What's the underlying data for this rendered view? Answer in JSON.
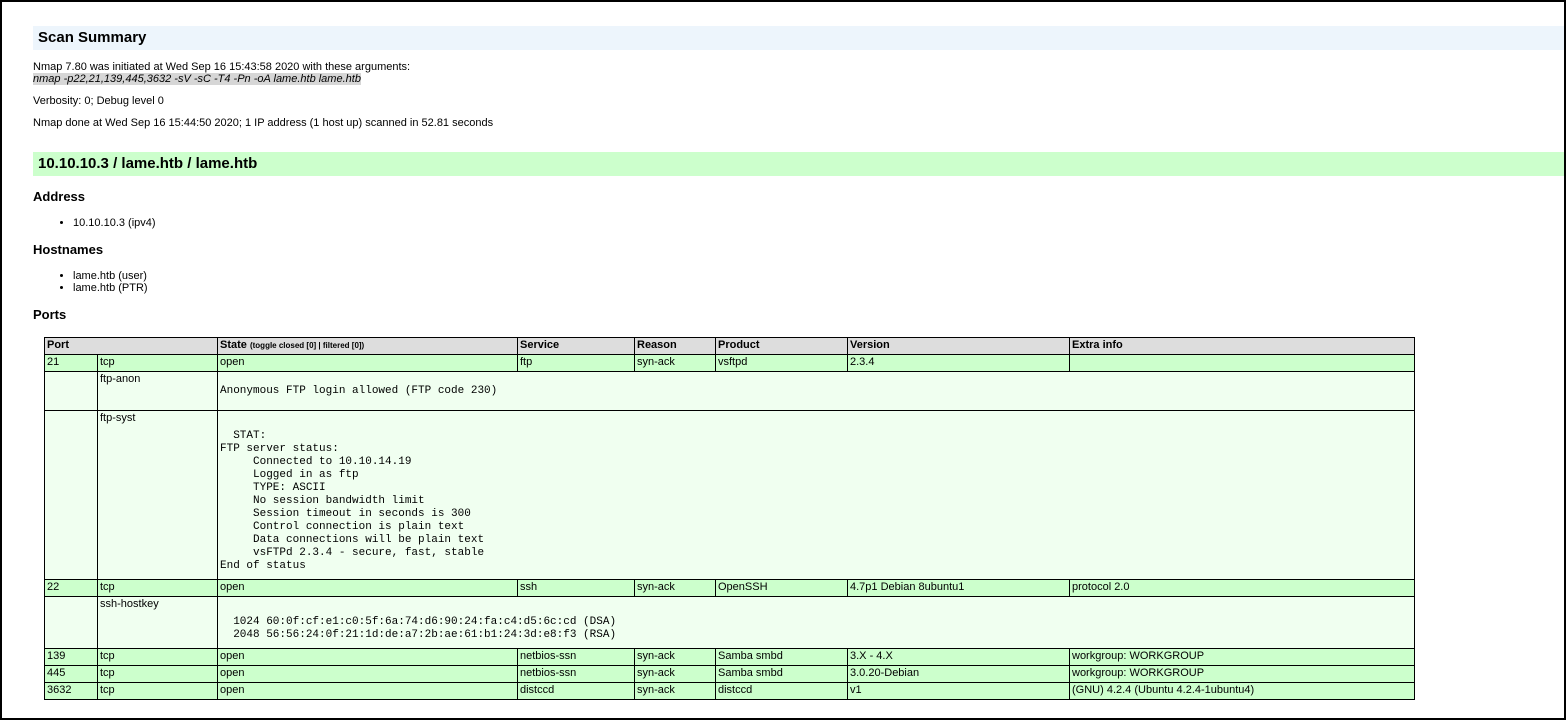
{
  "summary": {
    "heading": "Scan Summary",
    "initiated": "Nmap 7.80 was initiated at Wed Sep 16 15:43:58 2020 with these arguments:",
    "arguments": "nmap -p22,21,139,445,3632 -sV -sC -T4 -Pn -oA lame.htb lame.htb",
    "verbosity": "Verbosity: 0; Debug level 0",
    "done": "Nmap done at Wed Sep 16 15:44:50 2020; 1 IP address (1 host up) scanned in 52.81 seconds"
  },
  "host": {
    "heading": "10.10.10.3 / lame.htb / lame.htb",
    "address_heading": "Address",
    "addresses": [
      "10.10.10.3 (ipv4)"
    ],
    "hostnames_heading": "Hostnames",
    "hostnames": [
      "lame.htb (user)",
      "lame.htb (PTR)"
    ],
    "ports_heading": "Ports"
  },
  "ports_table": {
    "headers": {
      "port": "Port",
      "state": "State",
      "state_toggle": "(toggle closed [0] | filtered [0])",
      "service": "Service",
      "reason": "Reason",
      "product": "Product",
      "version": "Version",
      "extra": "Extra info"
    },
    "rows": [
      {
        "port": "21",
        "proto": "tcp",
        "state": "open",
        "service": "ftp",
        "reason": "syn-ack",
        "product": "vsftpd",
        "version": "2.3.4",
        "extra": ""
      },
      {
        "port": "22",
        "proto": "tcp",
        "state": "open",
        "service": "ssh",
        "reason": "syn-ack",
        "product": "OpenSSH",
        "version": "4.7p1 Debian 8ubuntu1",
        "extra": "protocol 2.0"
      },
      {
        "port": "139",
        "proto": "tcp",
        "state": "open",
        "service": "netbios-ssn",
        "reason": "syn-ack",
        "product": "Samba smbd",
        "version": "3.X - 4.X",
        "extra": "workgroup: WORKGROUP"
      },
      {
        "port": "445",
        "proto": "tcp",
        "state": "open",
        "service": "netbios-ssn",
        "reason": "syn-ack",
        "product": "Samba smbd",
        "version": "3.0.20-Debian",
        "extra": "workgroup: WORKGROUP"
      },
      {
        "port": "3632",
        "proto": "tcp",
        "state": "open",
        "service": "distccd",
        "reason": "syn-ack",
        "product": "distccd",
        "version": "v1",
        "extra": "(GNU) 4.2.4 (Ubuntu 4.2.4-1ubuntu4)"
      }
    ],
    "scripts": {
      "ftp_anon": {
        "name": "ftp-anon",
        "output": "Anonymous FTP login allowed (FTP code 230)"
      },
      "ftp_syst": {
        "name": "ftp-syst",
        "output": "\n  STAT: \nFTP server status:\n     Connected to 10.10.14.19\n     Logged in as ftp\n     TYPE: ASCII\n     No session bandwidth limit\n     Session timeout in seconds is 300\n     Control connection is plain text\n     Data connections will be plain text\n     vsFTPd 2.3.4 - secure, fast, stable\nEnd of status"
      },
      "ssh_hostkey": {
        "name": "ssh-hostkey",
        "output": "\n  1024 60:0f:cf:e1:c0:5f:6a:74:d6:90:24:fa:c4:d5:6c:cd (DSA)\n  2048 56:56:24:0f:21:1d:de:a7:2b:ae:61:b1:24:3d:e8:f3 (RSA)"
      }
    }
  }
}
